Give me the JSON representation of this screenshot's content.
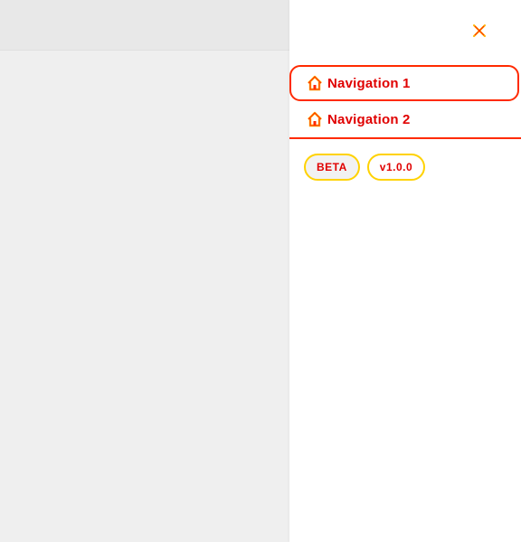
{
  "header": {
    "title": ""
  },
  "drawer": {
    "close_icon": "close-icon",
    "nav_items": [
      {
        "label": "Navigation 1",
        "icon": "home-icon",
        "active": true
      },
      {
        "label": "Navigation 2",
        "icon": "home-icon",
        "active": false
      }
    ],
    "badges": [
      {
        "label": "BETA"
      },
      {
        "label": "v1.0.0"
      }
    ]
  },
  "colors": {
    "accent": "#ff2a00",
    "text": "#e00000",
    "badge_border": "#ffd200",
    "backdrop": "#efefef",
    "drawer_bg": "#ffffff"
  }
}
